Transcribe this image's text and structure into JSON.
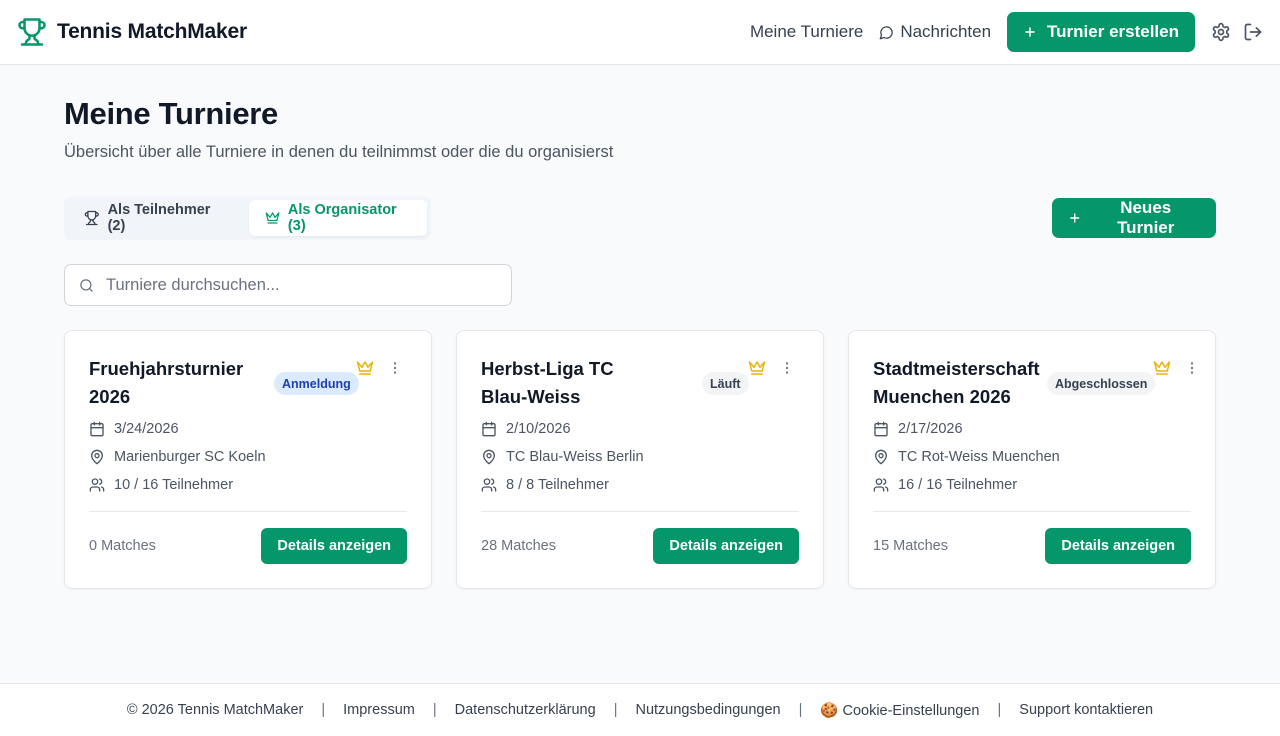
{
  "header": {
    "brand_name": "Tennis MatchMaker",
    "nav_my_tournaments": "Meine Turniere",
    "nav_messages": "Nachrichten",
    "create_button": "Turnier erstellen",
    "accent_color": "#059669"
  },
  "page": {
    "title": "Meine Turniere",
    "subtitle": "Übersicht über alle Turniere in denen du teilnimmst oder die du organisierst"
  },
  "tabs": [
    {
      "label": "Als Teilnehmer (2)",
      "icon": "trophy-icon",
      "active": false
    },
    {
      "label": "Als Organisator (3)",
      "icon": "crown-icon",
      "active": true
    }
  ],
  "new_tournament_button": "Neues Turnier",
  "search": {
    "placeholder": "Turniere durchsuchen...",
    "value": ""
  },
  "cards": [
    {
      "title": "Fruehjahrsturnier 2026",
      "status": "Anmeldung",
      "status_color": "blue",
      "date": "3/24/2026",
      "location": "Marienburger SC Koeln",
      "participants": "10 / 16 Teilnehmer",
      "matches": "0 Matches",
      "details_button": "Details anzeigen"
    },
    {
      "title": "Herbst-Liga TC Blau-Weiss",
      "status": "Läuft",
      "status_color": "gray",
      "date": "2/10/2026",
      "location": "TC Blau-Weiss Berlin",
      "participants": "8 / 8 Teilnehmer",
      "matches": "28 Matches",
      "details_button": "Details anzeigen"
    },
    {
      "title": "Stadtmeisterschaft Muenchen 2026",
      "status": "Abgeschlossen",
      "status_color": "gray",
      "date": "2/17/2026",
      "location": "TC Rot-Weiss Muenchen",
      "participants": "16 / 16 Teilnehmer",
      "matches": "15 Matches",
      "details_button": "Details anzeigen"
    }
  ],
  "footer": {
    "copyright": "© 2026 Tennis MatchMaker",
    "impressum": "Impressum",
    "privacy": "Datenschutzerklärung",
    "terms": "Nutzungsbedingungen",
    "cookie_icon": "🍪",
    "cookies": "Cookie-Einstellungen",
    "support": "Support kontaktieren"
  }
}
